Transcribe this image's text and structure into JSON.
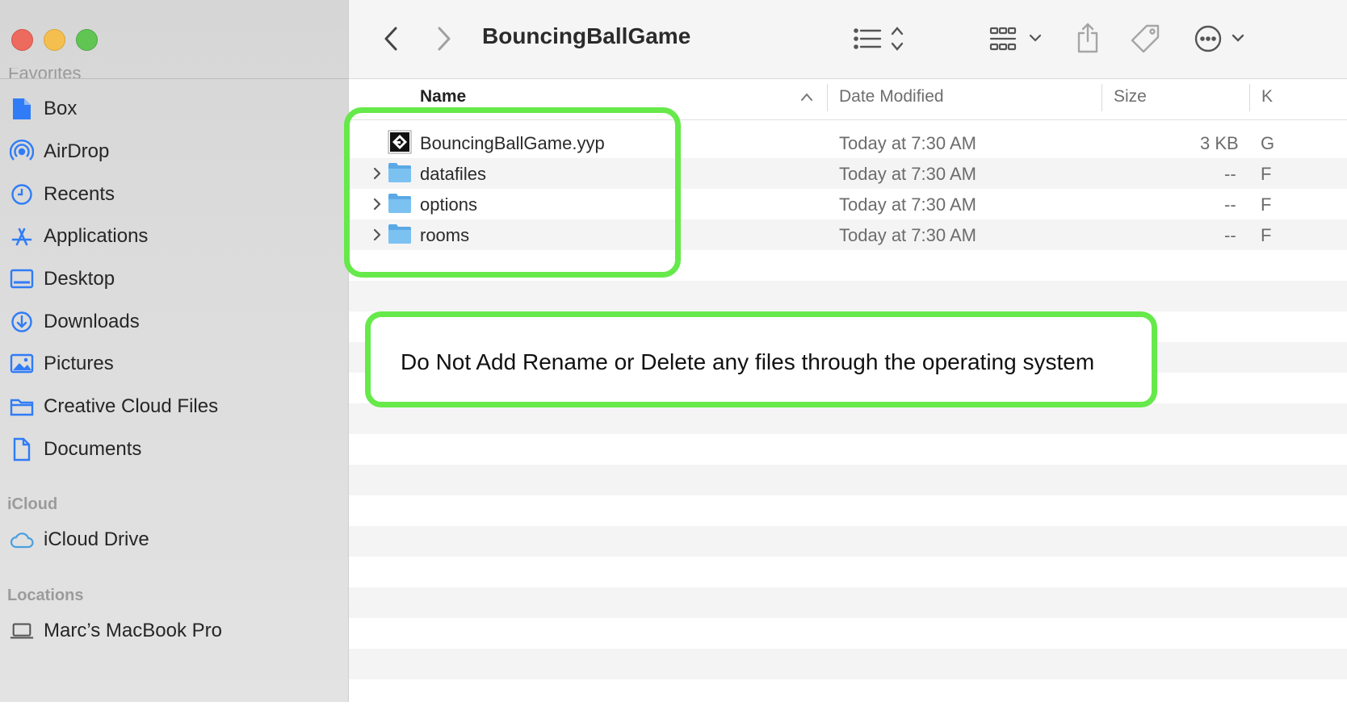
{
  "window": {
    "title": "BouncingBallGame"
  },
  "sidebar": {
    "favorites_header_ghost": "Favorites",
    "items": [
      {
        "label": "Box",
        "icon": "document-icon"
      },
      {
        "label": "AirDrop",
        "icon": "airdrop-icon"
      },
      {
        "label": "Recents",
        "icon": "clock-icon"
      },
      {
        "label": "Applications",
        "icon": "applications-icon"
      },
      {
        "label": "Desktop",
        "icon": "desktop-icon"
      },
      {
        "label": "Downloads",
        "icon": "download-icon"
      },
      {
        "label": "Pictures",
        "icon": "pictures-icon"
      },
      {
        "label": "Creative Cloud Files",
        "icon": "folder-icon"
      },
      {
        "label": "Documents",
        "icon": "document-icon"
      }
    ],
    "icloud_header": "iCloud",
    "icloud_items": [
      {
        "label": "iCloud Drive",
        "icon": "cloud-icon"
      }
    ],
    "locations_header": "Locations",
    "location_items": [
      {
        "label": "Marc’s MacBook Pro",
        "icon": "laptop-icon"
      }
    ]
  },
  "columns": {
    "name": "Name",
    "date_modified": "Date Modified",
    "size": "Size",
    "kind_partial": "K"
  },
  "files": [
    {
      "name": "BouncingBallGame.yyp",
      "date": "Today at 7:30 AM",
      "size": "3 KB",
      "kind_partial": "G",
      "type": "gamemaker-project"
    },
    {
      "name": "datafiles",
      "date": "Today at 7:30 AM",
      "size": "--",
      "kind_partial": "F",
      "type": "folder"
    },
    {
      "name": "options",
      "date": "Today at 7:30 AM",
      "size": "--",
      "kind_partial": "F",
      "type": "folder"
    },
    {
      "name": "rooms",
      "date": "Today at 7:30 AM",
      "size": "--",
      "kind_partial": "F",
      "type": "folder"
    }
  ],
  "annotation": {
    "warning_text": "Do Not Add Rename or Delete any files through the operating system"
  },
  "colors": {
    "accent_blue": "#2f7cf6",
    "annotation_green": "#66e94a",
    "folder_blue": "#6cb6ec"
  }
}
